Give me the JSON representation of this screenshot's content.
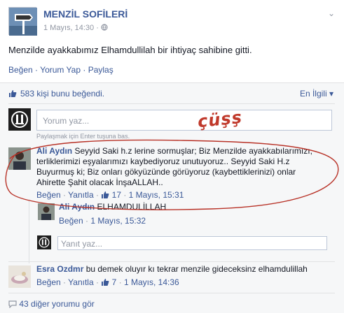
{
  "post": {
    "page_name": "MENZİL SOFİLERİ",
    "date": "1 Mayıs, 14:30",
    "separator": "·",
    "text": "Menzilde ayakkabımız Elhamdullilah bir ihtiyaç sahibine gitti.",
    "actions": [
      "Beğen",
      "Yorum Yap",
      "Paylaş"
    ]
  },
  "feedback": {
    "likes_text": "583 kişi bunu beğendi.",
    "sort_label": "En İlgili",
    "comment_placeholder": "Yorum yaz...",
    "hint": "Paylaşmak için Enter tuşuna bas.",
    "more_comments": "43 diğer yorumu gör"
  },
  "comments": [
    {
      "author": "Ali Aydın",
      "lines": [
        "Seyyid Saki h.z lerine sormuşlar; Biz Menzilde ayakkabılarımızı,",
        "terliklerimizi eşyalarımızı kaybediyoruz unutuyoruz.. Seyyid Saki H.z",
        "Buyurmuş ki; Biz onları gökyüzünde görüyoruz (kaybettiklerinizi) onlar",
        "Ahirette Şahit olacak İnşaALLAH.."
      ],
      "like": "Beğen",
      "reply": "Yanıtla",
      "like_count": "17",
      "time": "1 Mayıs, 15:31"
    },
    {
      "author": "Ali Aydın",
      "text": "ELHAMDULİLLAH",
      "like": "Beğen",
      "time": "1 Mayıs, 15:32"
    },
    {
      "author": "Esra Ozdmr",
      "text": "bu demek oluyır kı tekrar menzile gideceksinz elhamdulillah",
      "like": "Beğen",
      "reply": "Yanıtla",
      "like_count": "7",
      "time": "1 Mayıs, 14:36"
    }
  ],
  "reply_placeholder": "Yanıt yaz...",
  "annotation": "çüşş",
  "colors": {
    "link": "#3b5998",
    "muted": "#9197a3",
    "annotation": "#c0392b"
  }
}
